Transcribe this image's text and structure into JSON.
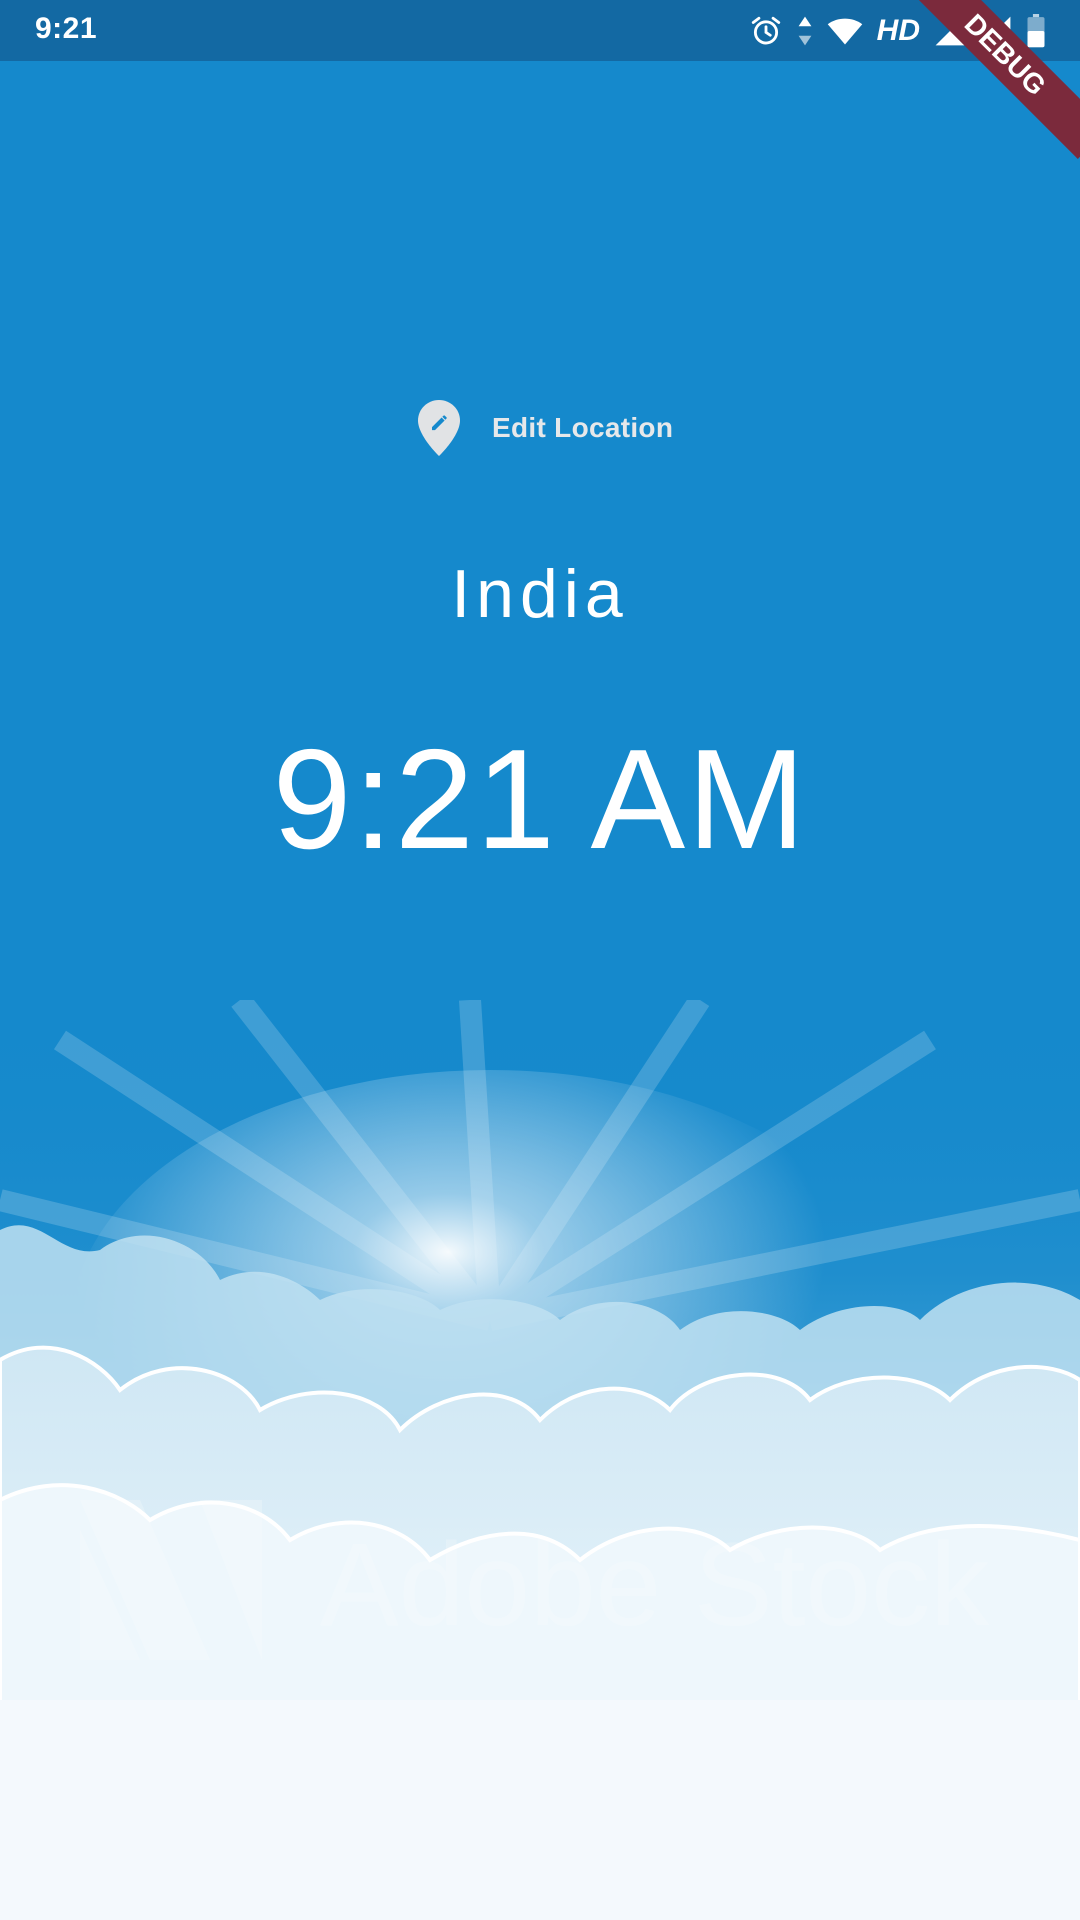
{
  "status_bar": {
    "time": "9:21",
    "network_label": "HD",
    "icons": [
      "alarm-icon",
      "data-arrows-icon",
      "wifi-icon",
      "signal-icon",
      "signal-icon",
      "battery-icon"
    ]
  },
  "debug_banner": {
    "label": "DEBUG",
    "color": "#7b2a3c"
  },
  "main": {
    "edit_location_label": "Edit Location",
    "edit_location_icon": "edit-location-icon",
    "location": "India",
    "time": "9:21 AM"
  },
  "background": {
    "watermark_text": "Adobe Stock",
    "sky_color": "#1589cc",
    "statusbar_color": "#1369a3"
  }
}
